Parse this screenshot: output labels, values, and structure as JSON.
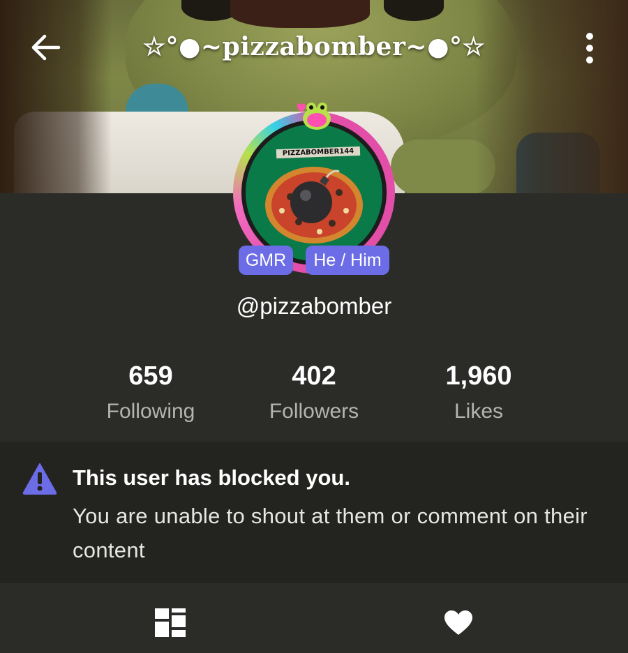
{
  "header": {
    "back_icon": "arrow-left-icon",
    "title": "☆°●~pizzabomber~●°☆",
    "menu_icon": "more-vertical-icon"
  },
  "profile": {
    "avatar_text": "PIZZABOMBER144",
    "tags": [
      "GMR",
      "He / Him"
    ],
    "username": "@pizzabomber"
  },
  "stats": [
    {
      "value": "659",
      "label": "Following"
    },
    {
      "value": "402",
      "label": "Followers"
    },
    {
      "value": "1,960",
      "label": "Likes"
    }
  ],
  "notice": {
    "icon": "warning-triangle-icon",
    "title": "This user has blocked you.",
    "description": "You are unable to shout at them or comment on their content"
  },
  "tabs": [
    {
      "icon": "dashboard-grid-icon"
    },
    {
      "icon": "heart-icon"
    }
  ],
  "colors": {
    "background": "#2b2c28",
    "notice_bg": "#232320",
    "tag_bg": "#6b6ce6",
    "warning_icon": "#6b6ce6",
    "stat_label": "#b4b4b0"
  }
}
